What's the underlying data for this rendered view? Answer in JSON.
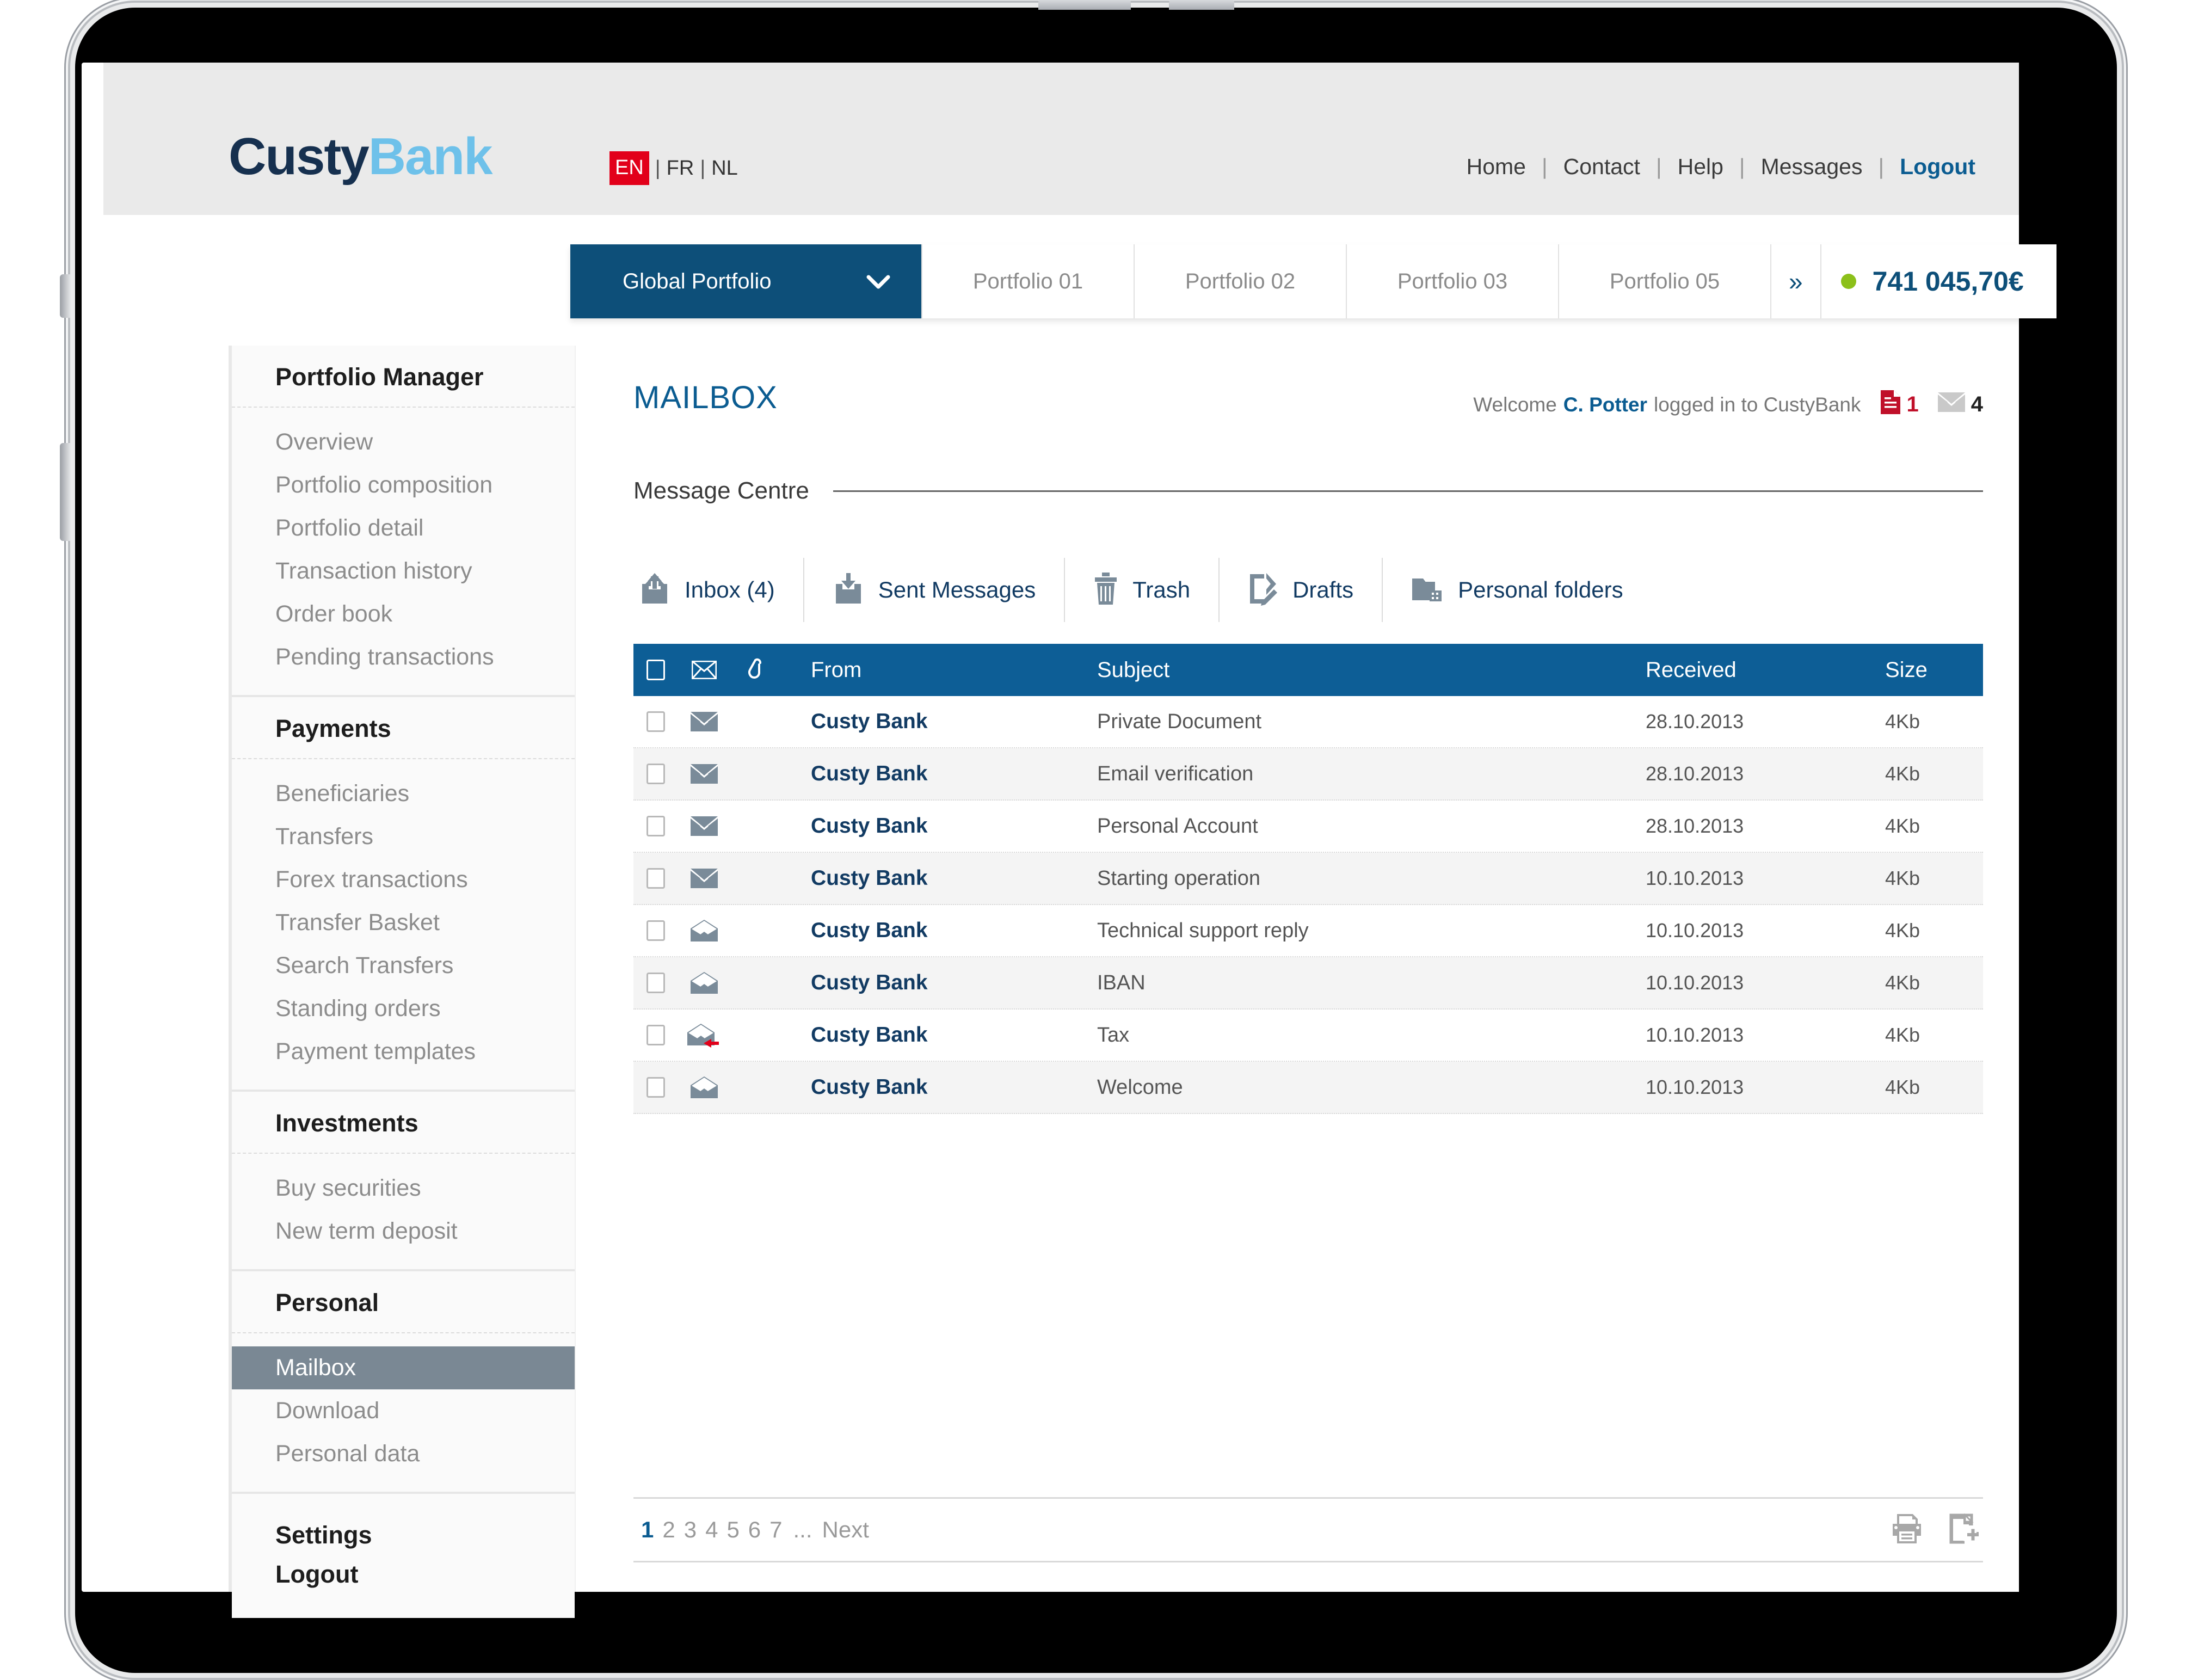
{
  "brand": {
    "part1": "Custy",
    "part2": "Bank"
  },
  "language": {
    "active": "EN",
    "options": [
      "EN",
      "FR",
      "NL"
    ],
    "separator": "|"
  },
  "topnav": {
    "items": [
      {
        "label": "Home",
        "active": false
      },
      {
        "label": "Contact",
        "active": false
      },
      {
        "label": "Help",
        "active": false
      },
      {
        "label": "Messages",
        "active": false
      },
      {
        "label": "Logout",
        "active": true
      }
    ],
    "separator": "|"
  },
  "portfolio_tabs": {
    "active": "Global Portfolio",
    "chevron": "⌄",
    "items": [
      "Global Portfolio",
      "Portfolio 01",
      "Portfolio 02",
      "Portfolio 03",
      "Portfolio 05"
    ],
    "more_icon": "»",
    "status_dot_color": "#8cc01a",
    "balance": "741 045,70€"
  },
  "sidebar": {
    "groups": [
      {
        "title": "Portfolio Manager",
        "items": [
          {
            "label": "Overview",
            "active": false
          },
          {
            "label": "Portfolio composition",
            "active": false
          },
          {
            "label": "Portfolio detail",
            "active": false
          },
          {
            "label": "Transaction history",
            "active": false
          },
          {
            "label": "Order book",
            "active": false
          },
          {
            "label": "Pending transactions",
            "active": false
          }
        ]
      },
      {
        "title": "Payments",
        "items": [
          {
            "label": "Beneficiaries",
            "active": false
          },
          {
            "label": "Transfers",
            "active": false
          },
          {
            "label": "Forex transactions",
            "active": false
          },
          {
            "label": "Transfer Basket",
            "active": false
          },
          {
            "label": "Search Transfers",
            "active": false
          },
          {
            "label": "Standing orders",
            "active": false
          },
          {
            "label": "Payment templates",
            "active": false
          }
        ]
      },
      {
        "title": "Investments",
        "items": [
          {
            "label": "Buy securities",
            "active": false
          },
          {
            "label": "New term deposit",
            "active": false
          }
        ]
      },
      {
        "title": "Personal",
        "items": [
          {
            "label": "Mailbox",
            "active": true
          },
          {
            "label": "Download",
            "active": false
          },
          {
            "label": "Personal data",
            "active": false
          }
        ]
      }
    ],
    "footer": [
      {
        "label": "Settings"
      },
      {
        "label": "Logout"
      }
    ]
  },
  "main": {
    "page_title": "MAILBOX",
    "welcome": {
      "prefix": "Welcome",
      "user": "C. Potter",
      "suffix": "logged in to CustyBank",
      "document_count": "1",
      "message_count": "4"
    },
    "section_label": "Message Centre",
    "folders": [
      {
        "label": "Inbox (4)",
        "icon": "inbox-icon"
      },
      {
        "label": "Sent Messages",
        "icon": "sent-icon"
      },
      {
        "label": "Trash",
        "icon": "trash-icon"
      },
      {
        "label": "Drafts",
        "icon": "drafts-icon"
      },
      {
        "label": "Personal  folders",
        "icon": "folder-icon"
      }
    ],
    "table": {
      "columns": {
        "checkbox": "",
        "envelope": "envelope-icon",
        "attachment": "paperclip-icon",
        "from": "From",
        "subject": "Subject",
        "received": "Received",
        "size": "Size"
      },
      "rows": [
        {
          "from": "Custy Bank",
          "subject": "Private Document",
          "received": "28.10.2013",
          "size": "4Kb",
          "read": false,
          "replied": false
        },
        {
          "from": "Custy Bank",
          "subject": "Email verification",
          "received": "28.10.2013",
          "size": "4Kb",
          "read": false,
          "replied": false
        },
        {
          "from": "Custy Bank",
          "subject": "Personal Account",
          "received": "28.10.2013",
          "size": "4Kb",
          "read": false,
          "replied": false
        },
        {
          "from": "Custy Bank",
          "subject": "Starting operation",
          "received": "10.10.2013",
          "size": "4Kb",
          "read": false,
          "replied": false
        },
        {
          "from": "Custy Bank",
          "subject": "Technical support reply",
          "received": "10.10.2013",
          "size": "4Kb",
          "read": true,
          "replied": false
        },
        {
          "from": "Custy Bank",
          "subject": "IBAN",
          "received": "10.10.2013",
          "size": "4Kb",
          "read": true,
          "replied": false
        },
        {
          "from": "Custy Bank",
          "subject": "Tax",
          "received": "10.10.2013",
          "size": "4Kb",
          "read": true,
          "replied": true
        },
        {
          "from": "Custy Bank",
          "subject": "Welcome",
          "received": "10.10.2013",
          "size": "4Kb",
          "read": true,
          "replied": false
        }
      ]
    },
    "pagination": {
      "pages": [
        "1",
        "2",
        "3",
        "4",
        "5",
        "6",
        "7"
      ],
      "current": "1",
      "ellipsis": "...",
      "next_label": "Next"
    },
    "footer_icons": [
      {
        "name": "print-icon"
      },
      {
        "name": "export-document-icon"
      }
    ]
  },
  "colors": {
    "brand_dark": "#16304f",
    "brand_light": "#6ec1ea",
    "accent_blue": "#0d5e96",
    "accent_red": "#e2001a",
    "status_green": "#8cc01a",
    "sidebar_active": "#7a8894"
  }
}
